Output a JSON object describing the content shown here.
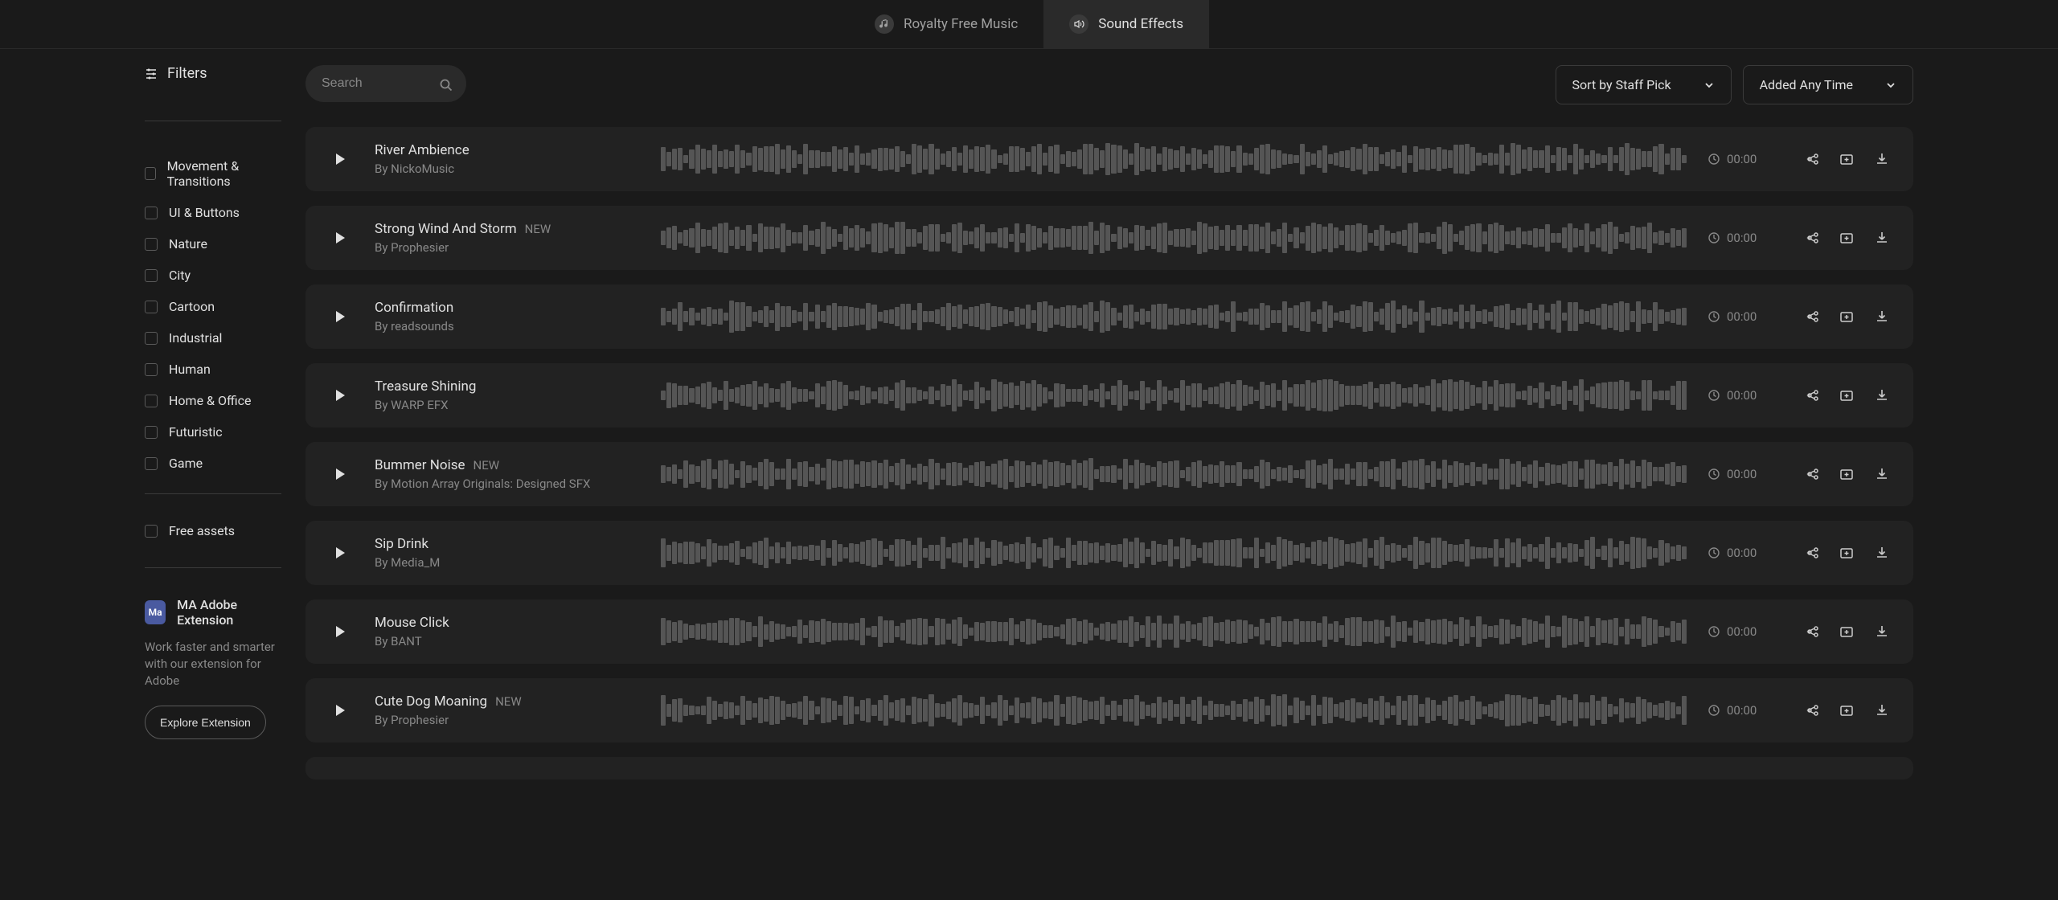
{
  "nav": {
    "music_label": "Royalty Free Music",
    "sfx_label": "Sound Effects"
  },
  "sidebar": {
    "filters_label": "Filters",
    "categories": [
      "Movement & Transitions",
      "UI & Buttons",
      "Nature",
      "City",
      "Cartoon",
      "Industrial",
      "Human",
      "Home & Office",
      "Futuristic",
      "Game"
    ],
    "free_assets_label": "Free assets",
    "extension": {
      "badge": "Ma",
      "title": "MA Adobe Extension",
      "desc": "Work faster and smarter with our extension for Adobe",
      "button": "Explore Extension"
    }
  },
  "toolbar": {
    "search_placeholder": "Search",
    "sort_label": "Sort by Staff Pick",
    "time_label": "Added Any Time"
  },
  "tracks": [
    {
      "title": "River Ambience",
      "author": "By NickoMusic",
      "new": false,
      "time": "00:00"
    },
    {
      "title": "Strong Wind And Storm",
      "author": "By Prophesier",
      "new": true,
      "time": "00:00"
    },
    {
      "title": "Confirmation",
      "author": "By readsounds",
      "new": false,
      "time": "00:00"
    },
    {
      "title": "Treasure Shining",
      "author": "By WARP EFX",
      "new": false,
      "time": "00:00"
    },
    {
      "title": "Bummer Noise",
      "author": "By Motion Array Originals: Designed SFX",
      "new": true,
      "time": "00:00"
    },
    {
      "title": "Sip Drink",
      "author": "By Media_M",
      "new": false,
      "time": "00:00"
    },
    {
      "title": "Mouse Click",
      "author": "By BANT",
      "new": false,
      "time": "00:00"
    },
    {
      "title": "Cute Dog Moaning",
      "author": "By Prophesier",
      "new": true,
      "time": "00:00"
    }
  ],
  "new_badge_text": "NEW"
}
